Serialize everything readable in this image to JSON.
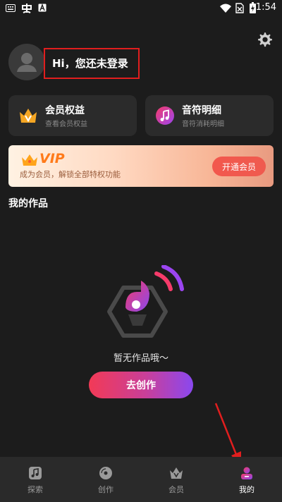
{
  "status_bar": {
    "time": "1:54",
    "icons": [
      "keyboard-icon",
      "app-icon",
      "a-icon",
      "wifi-icon",
      "no-sim-icon",
      "battery-charging-icon"
    ]
  },
  "header": {
    "settings_icon": "gear-icon"
  },
  "profile": {
    "greeting": "Hi，您还未登录",
    "avatar_icon": "user-icon"
  },
  "cards": [
    {
      "title": "会员权益",
      "subtitle": "查看会员权益",
      "icon": "crown-v-icon"
    },
    {
      "title": "音符明细",
      "subtitle": "音符消耗明细",
      "icon": "music-note-icon"
    }
  ],
  "vip_banner": {
    "badge": "VIP",
    "description": "成为会员，解锁全部特权功能",
    "button": "开通会员"
  },
  "section": {
    "title": "我的作品"
  },
  "empty_state": {
    "text": "暂无作品哦～",
    "button": "去创作",
    "illustration": "music-hexagon-icon"
  },
  "bottom_nav": {
    "items": [
      {
        "label": "探索",
        "icon": "explore-music-icon",
        "active": false
      },
      {
        "label": "创作",
        "icon": "disc-icon",
        "active": false
      },
      {
        "label": "会员",
        "icon": "crown-icon",
        "active": false
      },
      {
        "label": "我的",
        "icon": "profile-icon",
        "active": true
      }
    ]
  },
  "colors": {
    "background": "#1c1c1c",
    "card": "#2b2b2b",
    "accent_red": "#f23a56",
    "accent_purple": "#8a48ef",
    "vip_orange": "#ff7a1a",
    "annotation": "#e11e1e"
  }
}
